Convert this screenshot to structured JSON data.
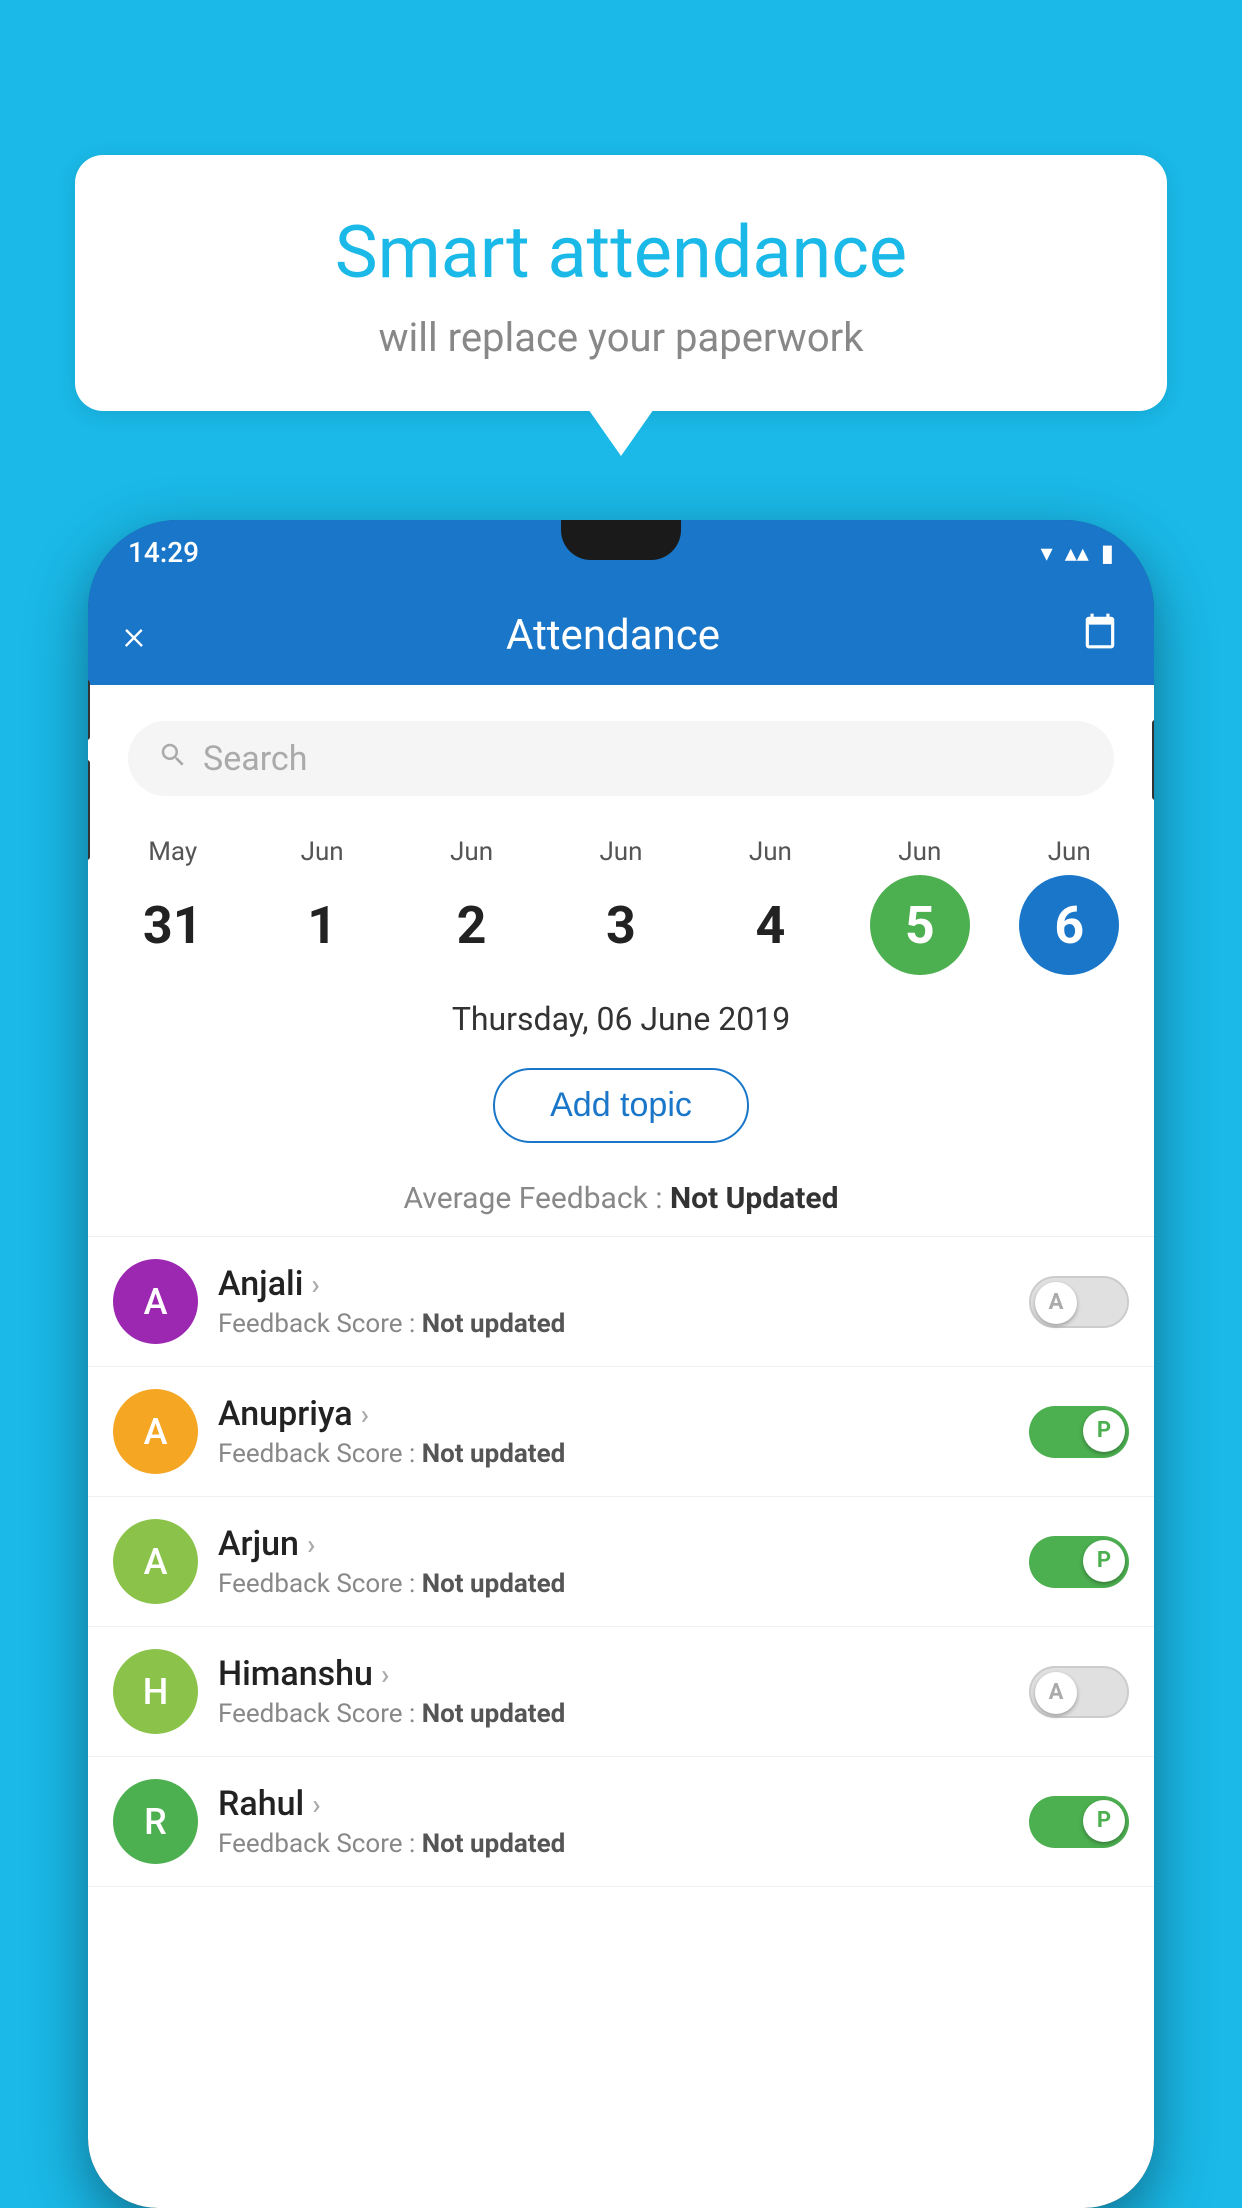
{
  "background_color": "#1ab9e8",
  "bubble": {
    "title": "Smart attendance",
    "subtitle": "will replace your paperwork"
  },
  "status_bar": {
    "time": "14:29",
    "icons": [
      "wifi",
      "signal",
      "battery"
    ]
  },
  "app_bar": {
    "close_label": "×",
    "title": "Attendance",
    "calendar_icon": "📅"
  },
  "search": {
    "placeholder": "Search"
  },
  "calendar": {
    "days": [
      {
        "month": "May",
        "date": "31",
        "style": "normal"
      },
      {
        "month": "Jun",
        "date": "1",
        "style": "normal"
      },
      {
        "month": "Jun",
        "date": "2",
        "style": "normal"
      },
      {
        "month": "Jun",
        "date": "3",
        "style": "normal"
      },
      {
        "month": "Jun",
        "date": "4",
        "style": "normal"
      },
      {
        "month": "Jun",
        "date": "5",
        "style": "today"
      },
      {
        "month": "Jun",
        "date": "6",
        "style": "selected"
      }
    ]
  },
  "selected_date": "Thursday, 06 June 2019",
  "add_topic_label": "Add topic",
  "avg_feedback_label": "Average Feedback : ",
  "avg_feedback_value": "Not Updated",
  "students": [
    {
      "name": "Anjali",
      "avatar_letter": "A",
      "avatar_color": "#9c27b0",
      "feedback": "Feedback Score : ",
      "feedback_value": "Not updated",
      "toggle": "off",
      "toggle_label": "A"
    },
    {
      "name": "Anupriya",
      "avatar_letter": "A",
      "avatar_color": "#f5a623",
      "feedback": "Feedback Score : ",
      "feedback_value": "Not updated",
      "toggle": "on",
      "toggle_label": "P"
    },
    {
      "name": "Arjun",
      "avatar_letter": "A",
      "avatar_color": "#8bc34a",
      "feedback": "Feedback Score : ",
      "feedback_value": "Not updated",
      "toggle": "on",
      "toggle_label": "P"
    },
    {
      "name": "Himanshu",
      "avatar_letter": "H",
      "avatar_color": "#8bc34a",
      "feedback": "Feedback Score : ",
      "feedback_value": "Not updated",
      "toggle": "off",
      "toggle_label": "A"
    },
    {
      "name": "Rahul",
      "avatar_letter": "R",
      "avatar_color": "#4caf50",
      "feedback": "Feedback Score : ",
      "feedback_value": "Not updated",
      "toggle": "on",
      "toggle_label": "P"
    }
  ]
}
